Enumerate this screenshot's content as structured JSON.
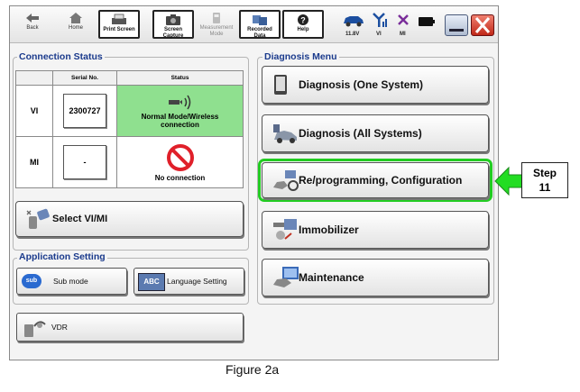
{
  "toolbar": {
    "back": "Back",
    "home": "Home",
    "print_screen": "Print Screen",
    "screen_capture": [
      "Screen",
      "Capture"
    ],
    "measurement_mode": [
      "Measurement",
      "Mode"
    ],
    "recorded_data": [
      "Recorded",
      "Data"
    ],
    "help": "Help",
    "voltage": "11.8V",
    "vi": "VI",
    "mi": "MI"
  },
  "connection_status": {
    "title": "Connection Status",
    "headers": [
      "Serial No.",
      "Status"
    ],
    "rows": [
      {
        "device": "VI",
        "serial": "2300727",
        "status": [
          "Normal Mode/Wireless",
          "connection"
        ],
        "status_color": "#8fe08f"
      },
      {
        "device": "MI",
        "serial": "-",
        "status": [
          "No connection"
        ],
        "status_color": "#ffffff"
      }
    ],
    "select_button": "Select VI/MI"
  },
  "application_setting": {
    "title": "Application Setting",
    "sub_mode": "Sub mode",
    "sub_badge": "sub",
    "language": "Language Setting",
    "abc_badge": "ABC",
    "vdr": "VDR"
  },
  "diagnosis_menu": {
    "title": "Diagnosis Menu",
    "items": [
      "Diagnosis (One System)",
      "Diagnosis (All Systems)",
      "Re/programming, Configuration",
      "Immobilizer",
      "Maintenance"
    ],
    "highlight_color": "#22cc22"
  },
  "callout": {
    "label": [
      "Step",
      "11"
    ],
    "arrow_color": "#22dd22"
  },
  "caption": "Figure 2a"
}
